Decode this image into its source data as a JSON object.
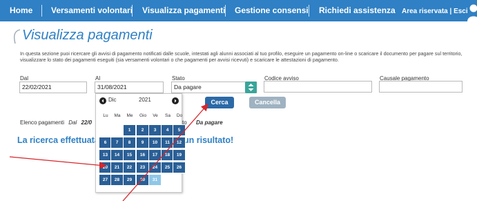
{
  "nav": {
    "items": [
      {
        "label": "Home"
      },
      {
        "label": "Versamenti volontari"
      },
      {
        "label": "Visualizza pagamenti"
      },
      {
        "label": "Gestione consensi"
      },
      {
        "label": "Richiedi assistenza"
      }
    ],
    "reserved_area": "Area riservata | Esci"
  },
  "page": {
    "title": "Visualizza pagamenti",
    "intro": "In questa sezione puoi ricercare gli avvisi di pagamento notificati dalle scuole, intestati agli alunni associati al tuo profilo, eseguire un pagamento on-line o scaricare il documento per pagare sul territorio, visualizzare lo stato dei pagamenti eseguiti (sia versamenti volontari o che pagamenti per avvisi ricevuti) e scaricare le attestazioni di pagamento."
  },
  "filters": {
    "dal_label": "Dal",
    "dal_value": "22/02/2021",
    "al_label": "Al",
    "al_value": "31/08/2021",
    "stato_label": "Stato",
    "stato_value": "Da pagare",
    "codice_label": "Codice avviso",
    "codice_value": "",
    "causale_label": "Causale pagamento",
    "causale_value": ""
  },
  "buttons": {
    "cerca": "Cerca",
    "cancella": "Cancella"
  },
  "results": {
    "elenco_label": "Elenco pagamenti",
    "dal_word": "Dal",
    "dal_value_fragment": "22/0",
    "stato_fragment": "to",
    "stato_value": "Da pagare",
    "message_start": "La ricerca effettuata",
    "message_end": "un risultato!"
  },
  "datepicker": {
    "month": "Dic",
    "year": "2021",
    "weekdays": [
      "Lu",
      "Ma",
      "Me",
      "Gio",
      "Ve",
      "Sa",
      "Do"
    ],
    "weeks": [
      [
        "",
        "",
        "1",
        "2",
        "3",
        "4",
        "5"
      ],
      [
        "6",
        "7",
        "8",
        "9",
        "10",
        "11",
        "12"
      ],
      [
        "13",
        "14",
        "15",
        "16",
        "17",
        "18",
        "19"
      ],
      [
        "20",
        "21",
        "22",
        "23",
        "24",
        "25",
        "26"
      ],
      [
        "27",
        "28",
        "29",
        "30",
        "31",
        "",
        ""
      ]
    ],
    "disabled_days": [
      "31"
    ],
    "day_color": "#2a5f96",
    "disabled_color": "#8fc7e8"
  },
  "colors": {
    "brand": "#2f80c4",
    "arrow": "#d8262b"
  }
}
